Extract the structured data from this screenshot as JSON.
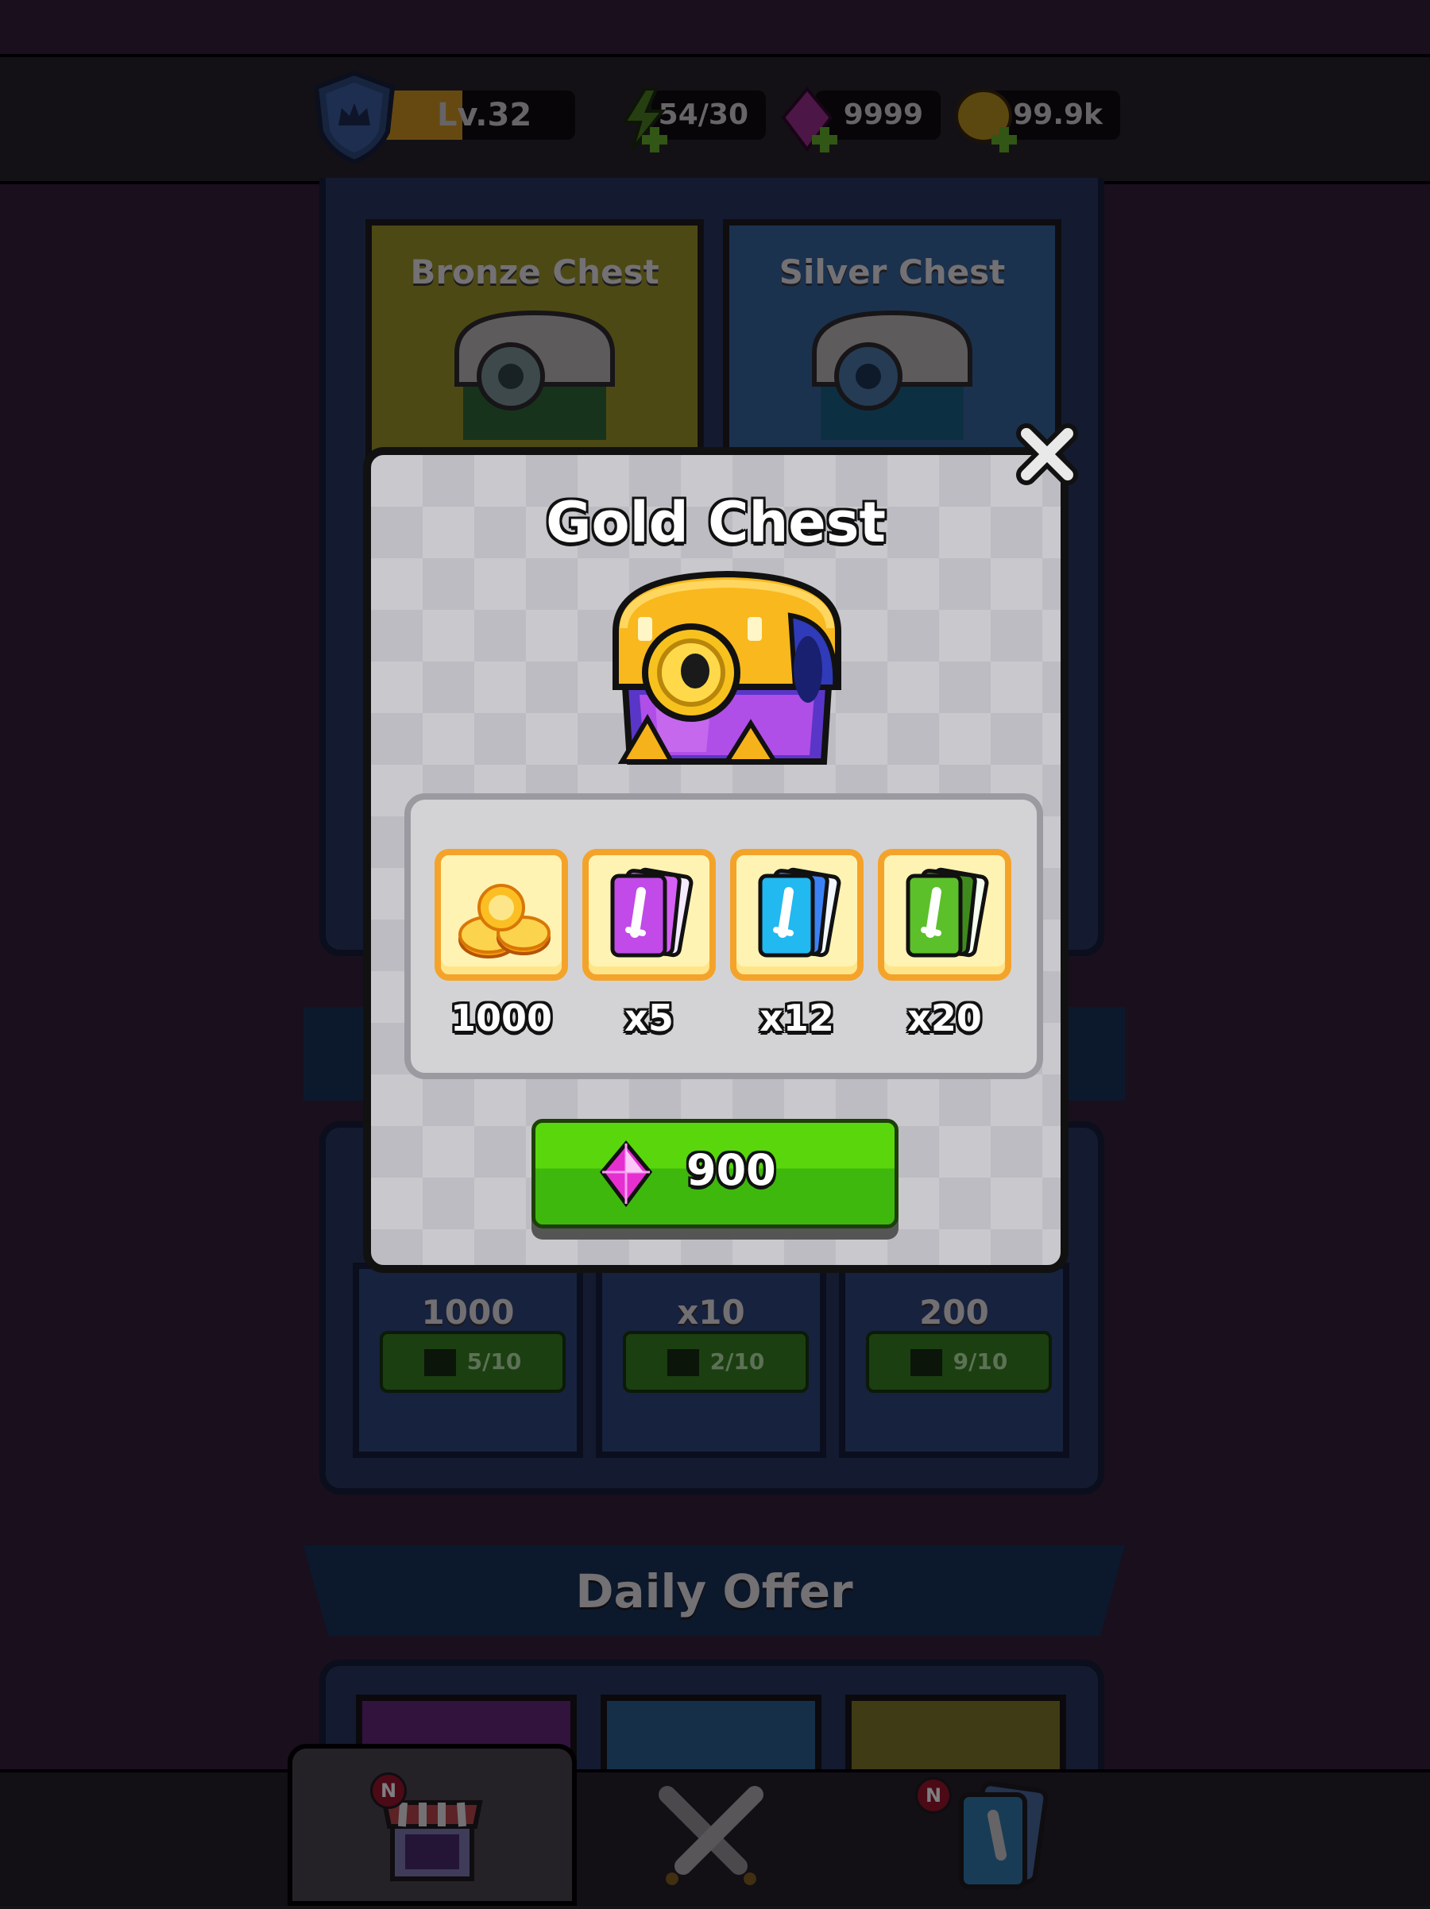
{
  "header": {
    "level_label": "Lv.32",
    "level_progress": 0.5,
    "energy": "54/30",
    "gems": "9999",
    "coins": "99.9k"
  },
  "shop": {
    "chests": [
      {
        "label": "Bronze Chest"
      },
      {
        "label": "Silver Chest"
      }
    ],
    "free_offers": [
      {
        "value": "1000",
        "ads": "5/10"
      },
      {
        "value": "x10",
        "ads": "2/10"
      },
      {
        "value": "200",
        "ads": "9/10"
      }
    ],
    "daily_offer_title": "Daily Offer"
  },
  "modal": {
    "title": "Gold Chest",
    "rewards": [
      {
        "icon": "gold-coins-icon",
        "value": "1000"
      },
      {
        "icon": "purple-cards-icon",
        "value": "x5"
      },
      {
        "icon": "blue-cards-icon",
        "value": "x12"
      },
      {
        "icon": "green-cards-icon",
        "value": "x20"
      }
    ],
    "price": "900",
    "price_icon": "gem-icon"
  },
  "nav": {
    "shop_badge": "N",
    "cards_badge": "N"
  },
  "colors": {
    "buy_green": "#4cc80e",
    "tile_border": "#f4a32a",
    "gem_pink": "#e62fd0"
  }
}
